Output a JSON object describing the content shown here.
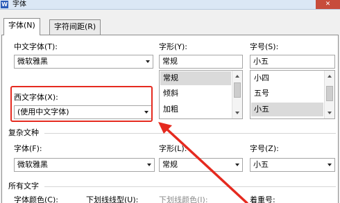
{
  "window": {
    "title": "字体",
    "app_icon_glyph": "W",
    "close_glyph": "✕"
  },
  "tabs": [
    {
      "label": "字体(N)"
    },
    {
      "label": "字符间距(R)"
    }
  ],
  "chinese_font": {
    "label": "中文字体(T):",
    "value": "微软雅黑"
  },
  "style": {
    "label": "字形(Y):",
    "value": "常规",
    "options": [
      "常规",
      "倾斜",
      "加粗"
    ],
    "selected": "常规"
  },
  "size": {
    "label": "字号(S):",
    "value": "小五",
    "options": [
      "小四",
      "五号",
      "小五"
    ],
    "selected": "小五"
  },
  "western_font": {
    "label": "西文字体(X):",
    "value": "(使用中文字体)"
  },
  "complex": {
    "section_title": "复杂文种",
    "font_label": "字体(F):",
    "font_value": "微软雅黑",
    "style_label": "字形(L):",
    "style_value": "常规",
    "size_label": "字号(Z):",
    "size_value": "小五"
  },
  "all_text": {
    "section_title": "所有文字",
    "color_label": "字体颜色(C):",
    "underline_label": "下划线线型(U):",
    "underline_color_label": "下划线颜色(I):",
    "emphasis_label": "着重号:"
  },
  "colors": {
    "annotation_red": "#e52a1f",
    "selected_item": "#dadada"
  }
}
